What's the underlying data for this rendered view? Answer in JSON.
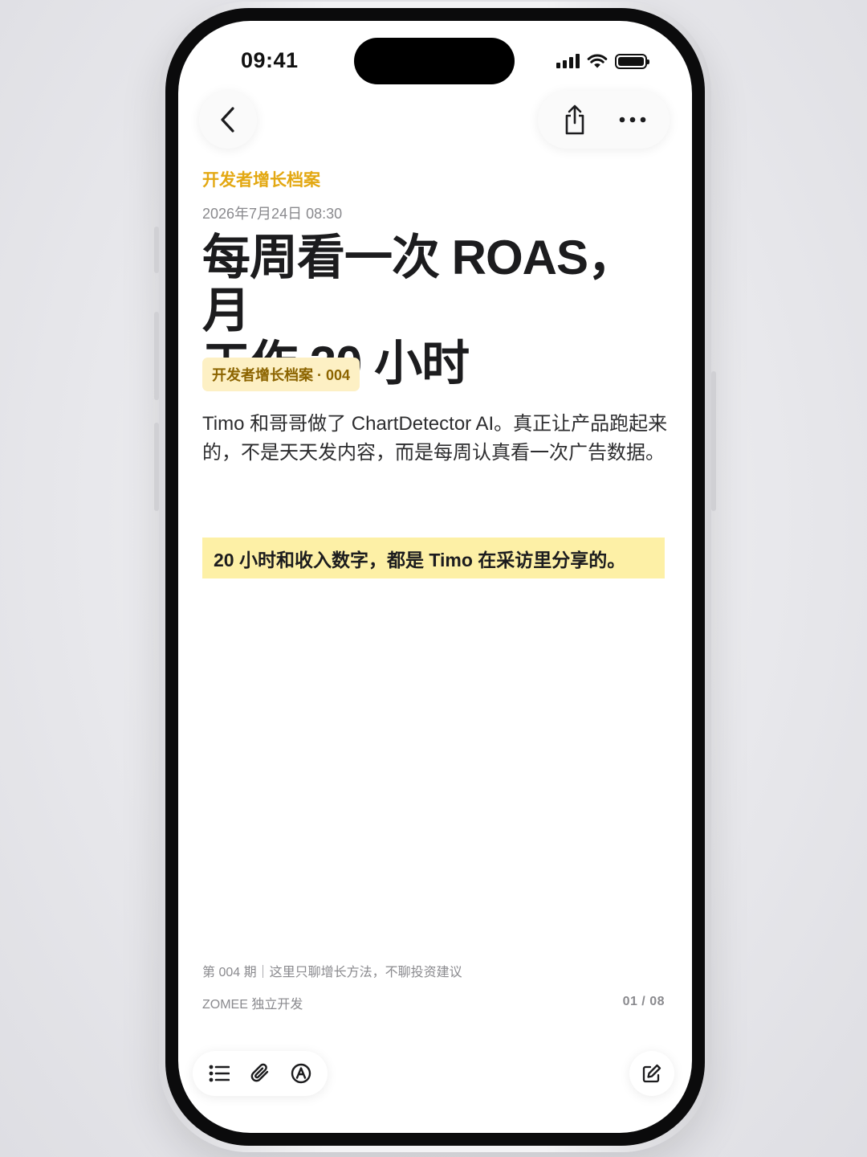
{
  "status_bar": {
    "time": "09:41",
    "icons": [
      "signal-icon",
      "wifi-icon",
      "battery-icon"
    ]
  },
  "nav": {
    "back_icon": "chevron-left-icon",
    "share_icon": "share-icon",
    "more_icon": "ellipsis-icon"
  },
  "article": {
    "category": "开发者增长档案",
    "timestamp": "2026年7月24日 08:30",
    "title_line1": "每周看一次 ROAS，月",
    "title_line2": "工作 20 小时",
    "series_tag": "开发者增长档案 · 004",
    "intro": "Timo 和哥哥做了 ChartDetector AI。真正让产品跑起来的，不是天天发内容，而是每周认真看一次广告数据。",
    "highlight": "20 小时和收入数字，都是 Timo 在采访里分享的。"
  },
  "footer": {
    "note": "第 004 期｜这里只聊增长方法，不聊投资建议",
    "brand": "ZOMEE 独立开发",
    "page_counter": "01 / 08"
  },
  "toolbar": {
    "items": [
      "checklist-icon",
      "paperclip-icon",
      "markup-icon"
    ],
    "compose_icon": "compose-icon"
  },
  "colors": {
    "accent": "#e3a812",
    "tag_bg": "#fdf0c4",
    "tag_text": "#8c6400",
    "highlight_bg": "#fdf0a6"
  }
}
